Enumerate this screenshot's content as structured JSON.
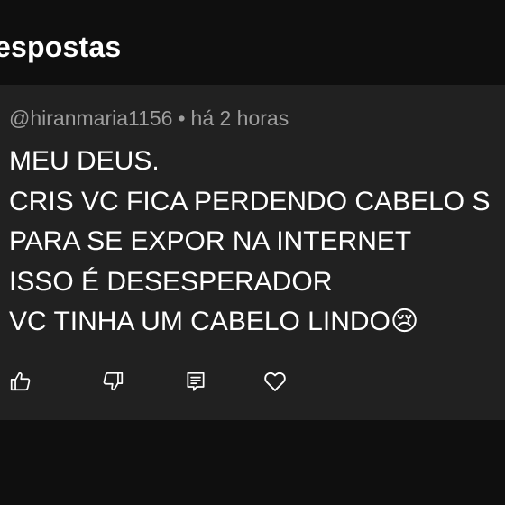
{
  "header": {
    "title": "espostas"
  },
  "comment": {
    "author": "@hiranmaria1156",
    "separator": "•",
    "time": "há 2 horas",
    "lines": [
      "MEU DEUS.",
      "CRIS VC FICA PERDENDO CABELO S",
      "PARA SE EXPOR NA INTERNET",
      "ISSO É  DESESPERADOR",
      "VC TINHA UM  CABELO  LINDO😢"
    ]
  },
  "actions": [
    {
      "icon": "thumbs-up-icon"
    },
    {
      "icon": "thumbs-down-icon"
    },
    {
      "icon": "reply-icon"
    },
    {
      "icon": "heart-icon"
    }
  ],
  "colors": {
    "background": "#0f0f0f",
    "card": "#212121",
    "meta_text": "#9e9e9e",
    "text": "#ffffff"
  }
}
